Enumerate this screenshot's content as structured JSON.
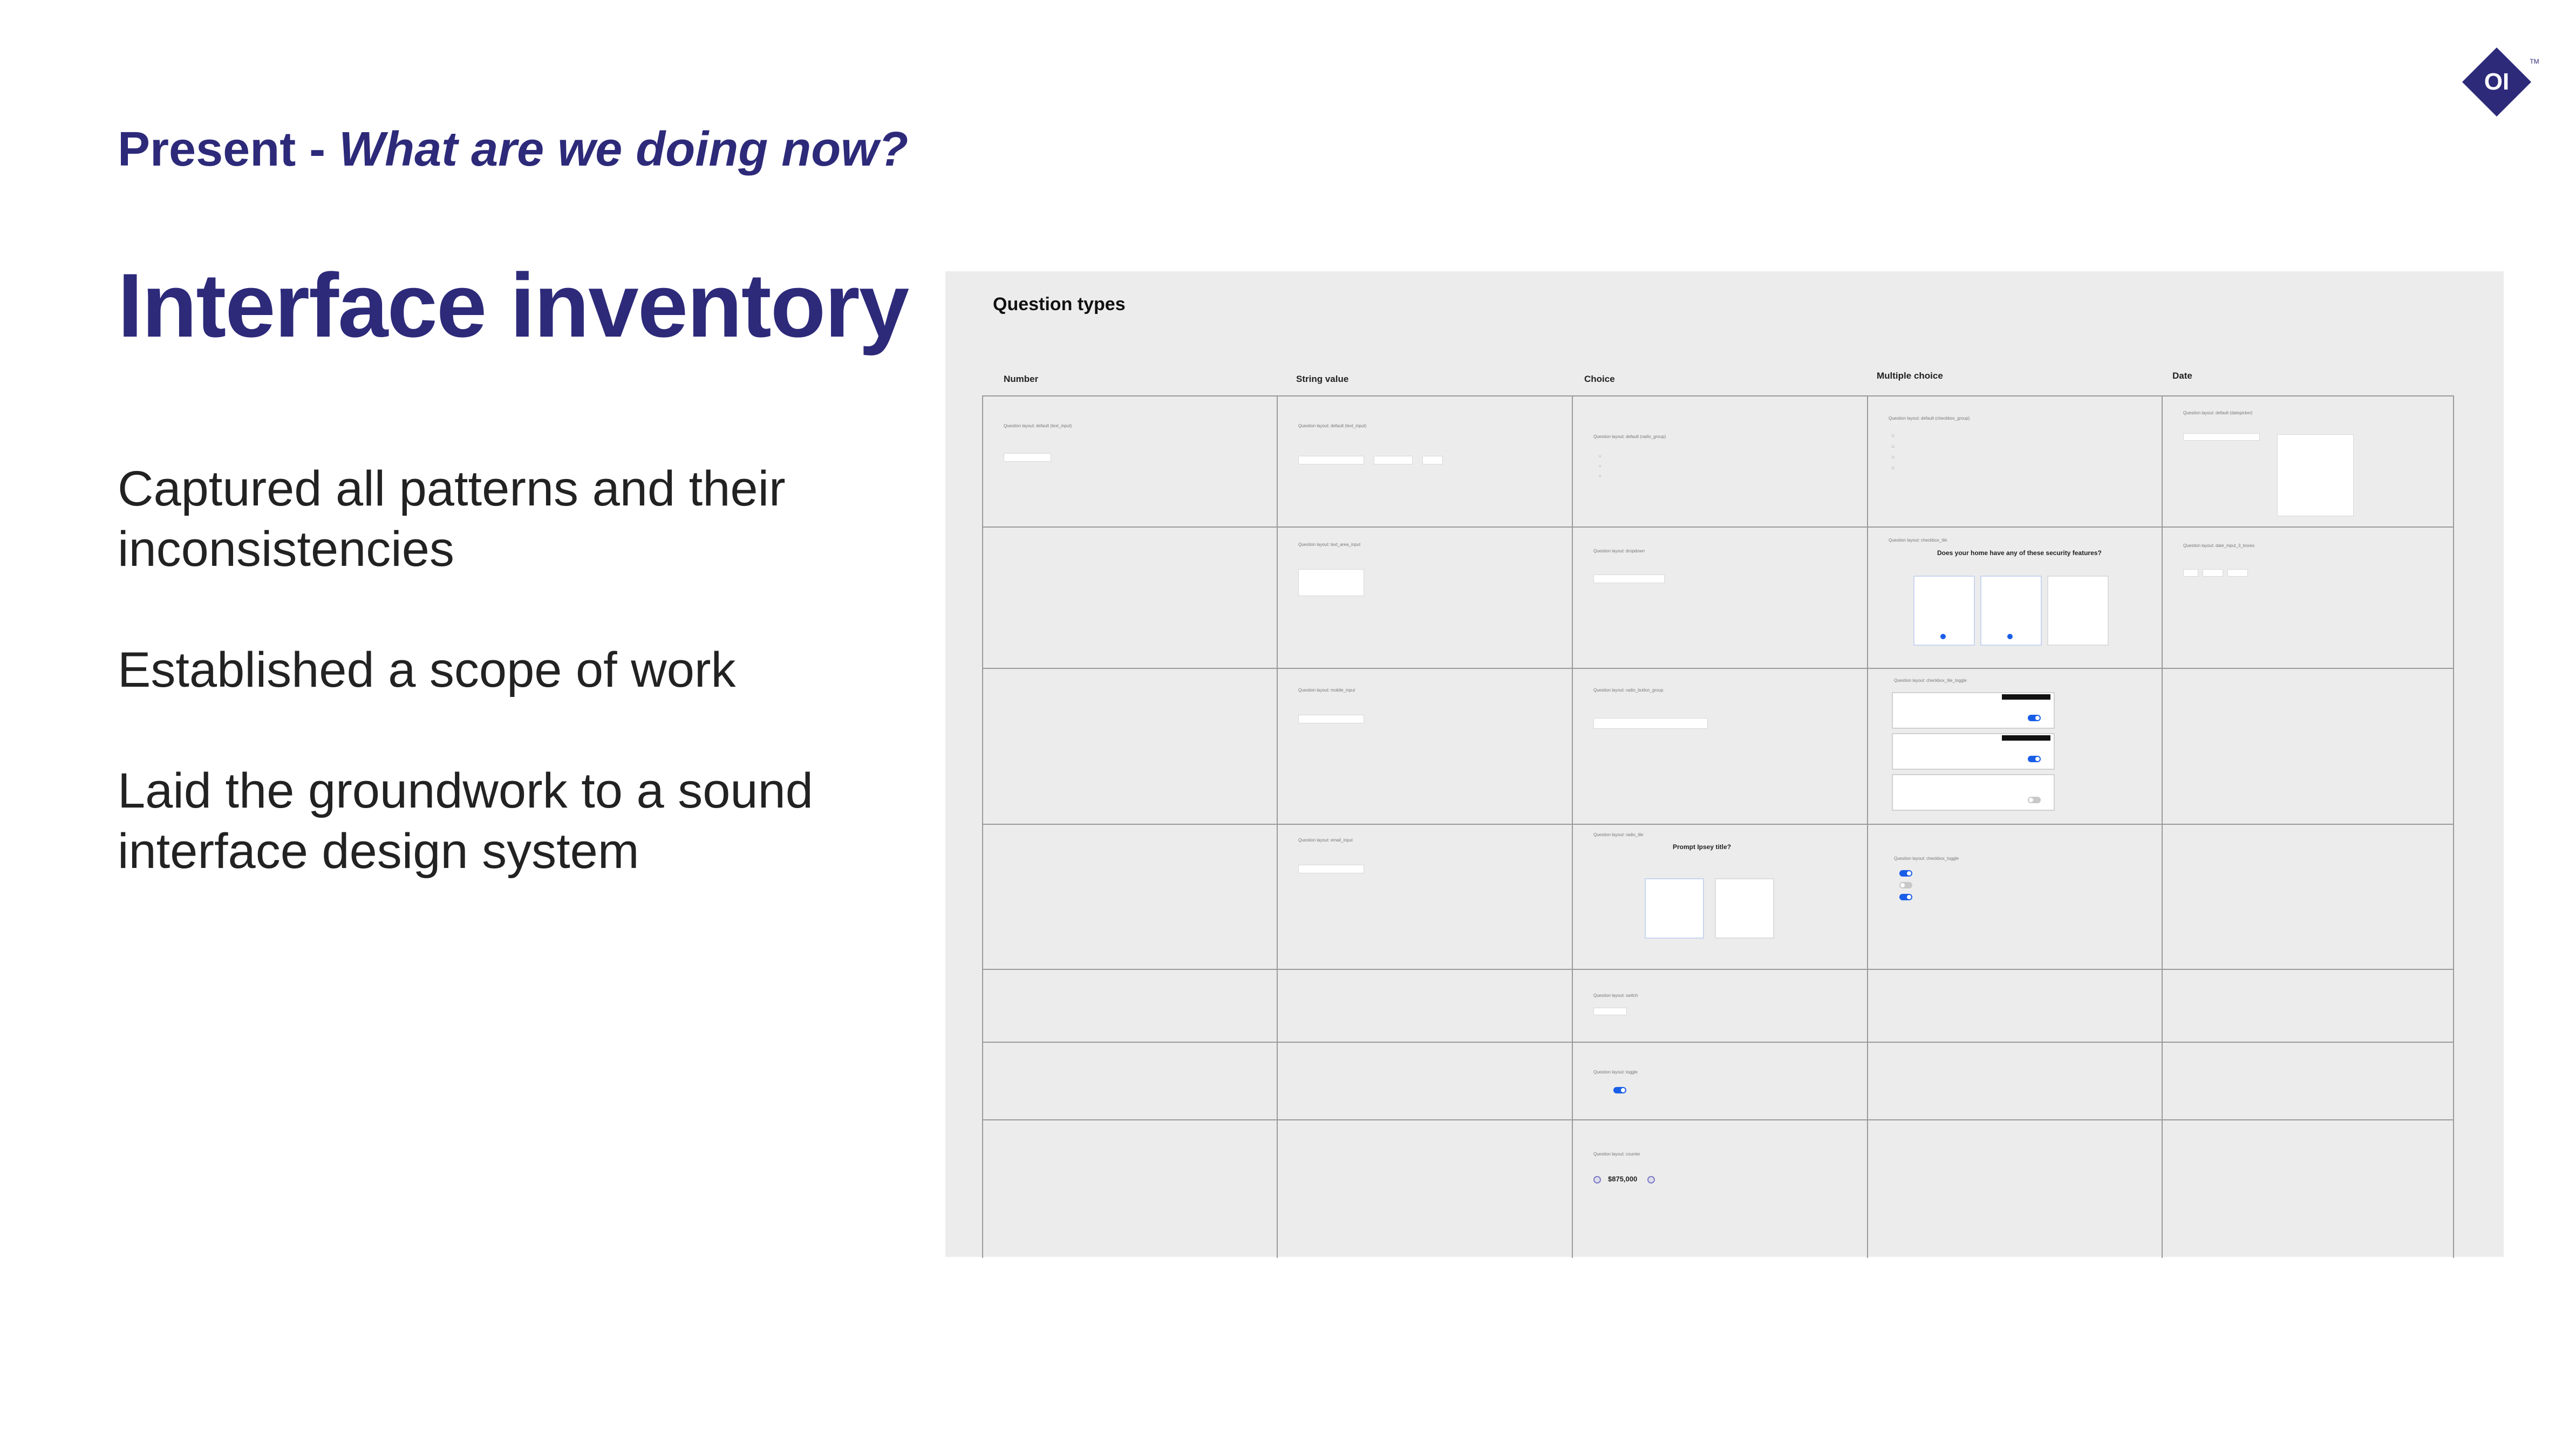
{
  "brand": {
    "logo_text": "OI",
    "trademark": "TM",
    "color": "#2d2a7a"
  },
  "header": {
    "prefix": "Present - ",
    "question": "What are we doing now?"
  },
  "title": "Interface inventory",
  "bullets": [
    "Captured all patterns and their inconsistencies",
    "Established a scope of work",
    "Laid the groundwork to a sound interface design system"
  ],
  "inventory": {
    "title": "Question types",
    "columns": [
      "Number",
      "String value",
      "Choice",
      "Multiple choice",
      "Date"
    ],
    "cells": {
      "number_r1": "Question layout: default (text_input)",
      "string_r1": "Question layout: default (text_input)",
      "string_r2": "Question layout: text_area_input",
      "string_r3": "Question layout: mobile_input",
      "string_r4": "Question layout: email_input",
      "choice_r1": "Question layout: default (radio_group)",
      "choice_r2": "Question layout: dropdown",
      "choice_r3": "Question layout: radio_button_group",
      "choice_r4": "Question layout: radio_tile",
      "choice_r5": "Question layout: switch",
      "choice_r6": "Question layout: toggle",
      "choice_r7": "Question layout: counter",
      "multi_r1": "Question layout: default (checkbox_group)",
      "multi_r2": "Question layout: checkbox_tile",
      "multi_r3": "Question layout: checkbox_tile_toggle",
      "multi_r4": "Question layout: checkbox_toggle",
      "date_r1": "Question layout: default (datepicker)",
      "date_r2": "Question layout: date_input_3_boxes"
    },
    "multi_question": "Does your home have any of these security features?",
    "prompt_title": "Prompt Ipsey title?",
    "counter_value": "$875,000",
    "accent_color": "#1a5ee8"
  }
}
